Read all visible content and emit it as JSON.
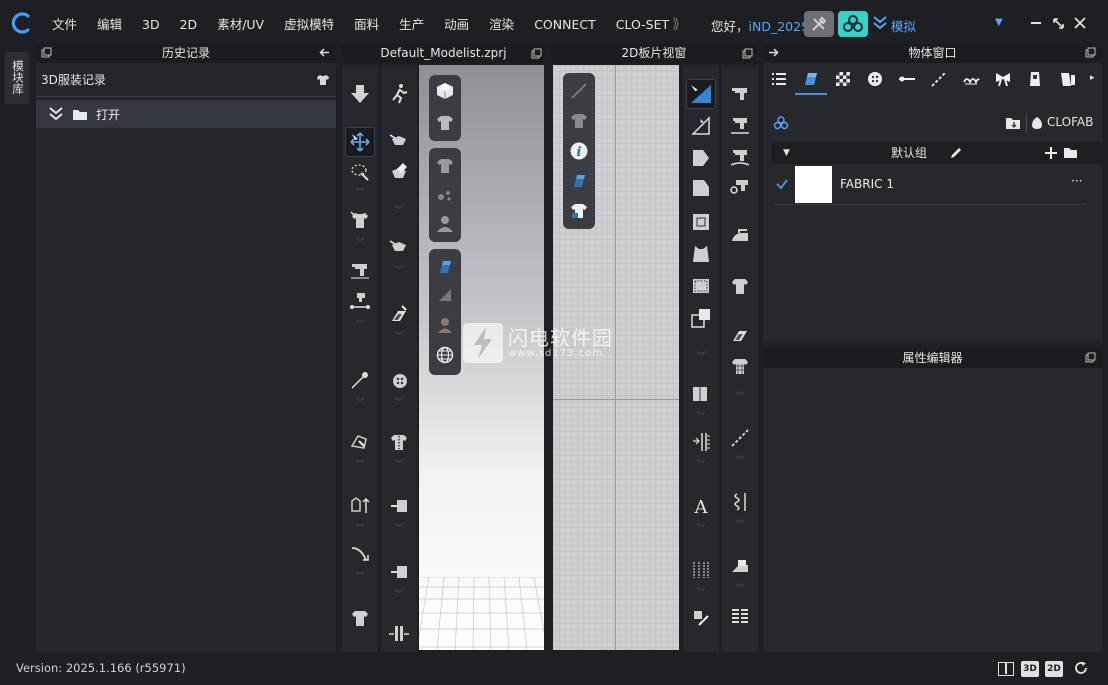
{
  "menu": {
    "items": [
      "文件",
      "编辑",
      "3D",
      "2D",
      "素材/UV",
      "虚拟模特",
      "面料",
      "生产",
      "动画",
      "渲染",
      "CONNECT",
      "CLO-SET"
    ],
    "more": "⟫",
    "greeting": "您好，",
    "username": "iND_2025",
    "mode": "模拟"
  },
  "side_tab": {
    "label": "模块库"
  },
  "history": {
    "title": "历史记录",
    "subtitle": "3D服装记录",
    "rows": [
      {
        "label": "打开"
      }
    ]
  },
  "view3d": {
    "title": "Default_Modelist.zprj"
  },
  "view2d": {
    "title": "2D板片视窗"
  },
  "object_window": {
    "title": "物体窗口",
    "brand": "CLOFAB",
    "group_label": "默认组",
    "fabrics": [
      {
        "name": "FABRIC 1",
        "more": "···"
      }
    ]
  },
  "property_editor": {
    "title": "属性编辑器"
  },
  "status": {
    "version": "Version: 2025.1.166 (r55971)",
    "btn_3d": "3D",
    "btn_2d": "2D"
  },
  "watermark": {
    "title": "闪电软件园",
    "url": "www.sd173.com"
  },
  "colors": {
    "accent": "#4a90e2",
    "link": "#55a6ff",
    "panel": "#26282c",
    "background": "#1e1f22"
  }
}
